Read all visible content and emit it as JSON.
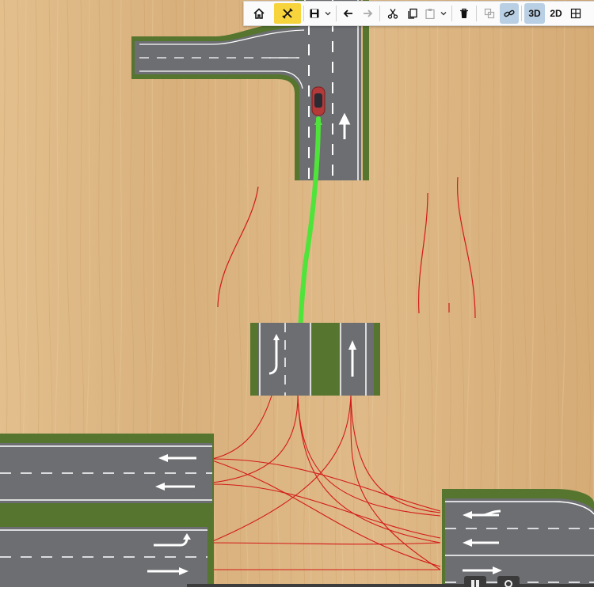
{
  "toolbar": {
    "buttons": [
      {
        "name": "home-button",
        "icon": "home-icon",
        "state": "normal"
      },
      {
        "name": "edit-tools-button",
        "icon": "tools-icon",
        "state": "active"
      },
      {
        "name": "save-button",
        "icon": "save-icon",
        "state": "normal"
      },
      {
        "name": "save-dropdown-button",
        "icon": "chevron-down-icon",
        "state": "normal"
      },
      {
        "name": "undo-button",
        "icon": "arrow-left-icon",
        "state": "normal"
      },
      {
        "name": "redo-button",
        "icon": "arrow-right-icon",
        "state": "disabled"
      },
      {
        "name": "cut-button",
        "icon": "scissors-icon",
        "state": "normal"
      },
      {
        "name": "copy-button",
        "icon": "copy-icon",
        "state": "normal"
      },
      {
        "name": "paste-button",
        "icon": "paste-icon",
        "state": "disabled"
      },
      {
        "name": "paste-dropdown-button",
        "icon": "chevron-down-icon",
        "state": "normal"
      },
      {
        "name": "delete-button",
        "icon": "trash-icon",
        "state": "normal"
      },
      {
        "name": "duplicate-button",
        "icon": "duplicate-icon",
        "state": "disabled"
      },
      {
        "name": "link-button",
        "icon": "link-icon",
        "state": "on"
      }
    ],
    "view_3d_label": "3D",
    "view_2d_label": "2D",
    "grid_icon": "grid-icon",
    "active_view": "3D"
  },
  "scene": {
    "ground": "wood-texture",
    "colors": {
      "wood": "#dcb584",
      "asphalt": "#6f7174",
      "grass": "#5b7a36",
      "road_edge": "#475a2a",
      "lane_line": "#ffffff",
      "path_highlight": "#4fe43a",
      "connector_lines": "#d31a1a",
      "vehicle": "#b43a3a"
    },
    "vehicle": "car-icon",
    "selected_path": "green-route"
  }
}
